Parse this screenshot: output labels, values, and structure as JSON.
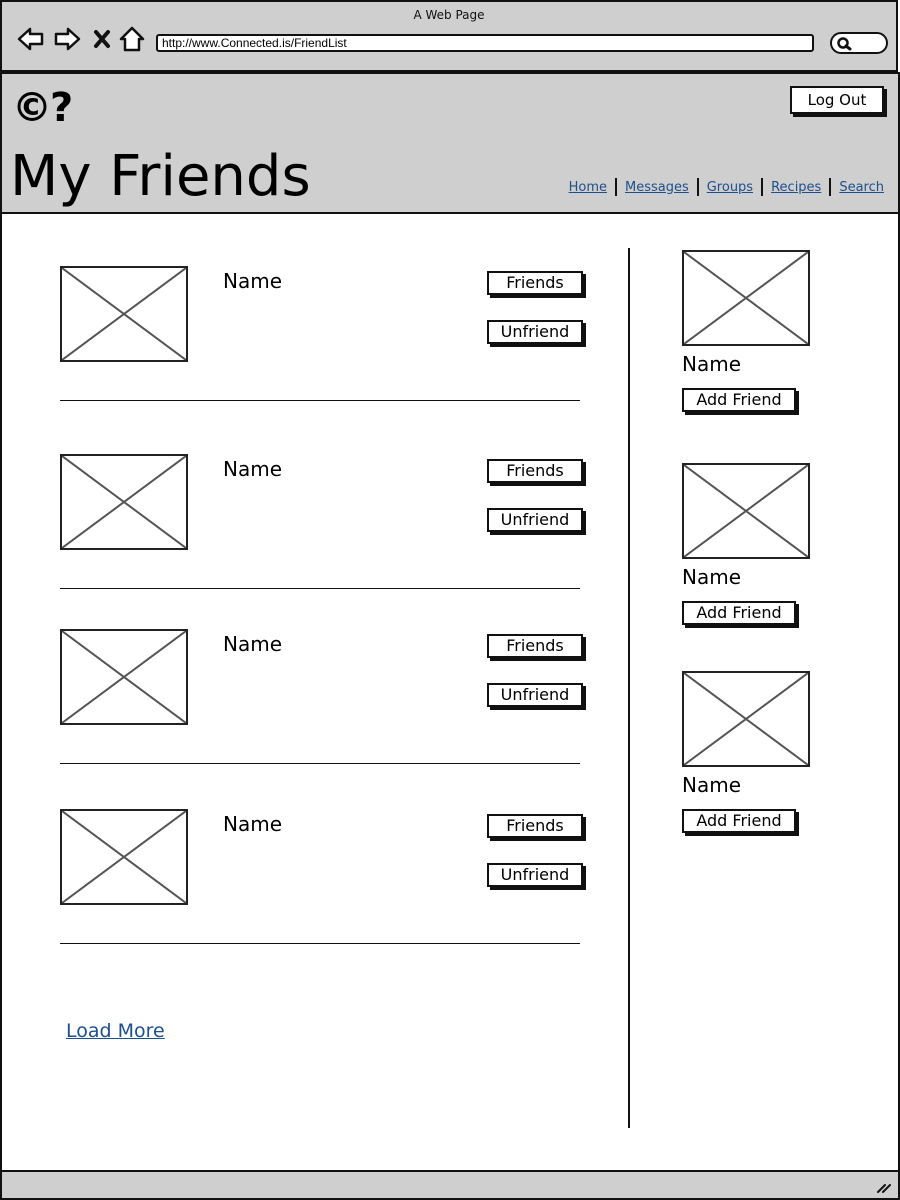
{
  "window": {
    "title": "A Web Page"
  },
  "address_bar": {
    "url": "http://www.Connected.is/FriendList"
  },
  "header": {
    "logo": "©?",
    "title": "My Friends",
    "logout_label": "Log Out",
    "nav": [
      "Home",
      "Messages",
      "Groups",
      "Recipes",
      "Search"
    ]
  },
  "friends": [
    {
      "name": "Name",
      "friends_label": "Friends",
      "unfriend_label": "Unfriend"
    },
    {
      "name": "Name",
      "friends_label": "Friends",
      "unfriend_label": "Unfriend"
    },
    {
      "name": "Name",
      "friends_label": "Friends",
      "unfriend_label": "Unfriend"
    },
    {
      "name": "Name",
      "friends_label": "Friends",
      "unfriend_label": "Unfriend"
    }
  ],
  "load_more_label": "Load More",
  "suggestions": [
    {
      "name": "Name",
      "add_label": "Add Friend"
    },
    {
      "name": "Name",
      "add_label": "Add Friend"
    },
    {
      "name": "Name",
      "add_label": "Add Friend"
    }
  ],
  "icons": {
    "back": "back-arrow-icon",
    "forward": "forward-arrow-icon",
    "stop": "close-icon",
    "home": "home-icon",
    "search": "search-icon",
    "resize": "resize-grip-icon"
  }
}
